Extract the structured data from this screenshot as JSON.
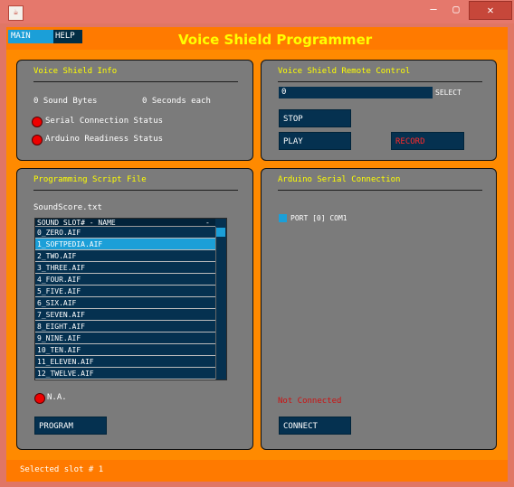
{
  "window": {
    "min_glyph": "—",
    "max_glyph": "▢",
    "close_glyph": "✕",
    "app_icon": "java-cup-icon"
  },
  "menu": {
    "main": "MAIN",
    "help": "HELP"
  },
  "app_title": "Voice Shield Programmer",
  "info_panel": {
    "title": "Voice Shield Info",
    "sound_bytes": "0 Sound Bytes",
    "seconds_each": "0 Seconds each",
    "serial_status": "Serial Connection Status",
    "arduino_status": "Arduino Readiness Status"
  },
  "remote_panel": {
    "title": "Voice Shield Remote Control",
    "slot_value": "0",
    "select_label": "SELECT",
    "stop": "STOP",
    "play": "PLAY",
    "record": "RECORD"
  },
  "script_panel": {
    "title": "Programming Script File",
    "file_name": "SoundScore.txt",
    "list_header": "SOUND SLOT#  - NAME",
    "list_header_sort": "-",
    "items": [
      "0_ZERO.AIF",
      "1_SOFTPEDIA.AIF",
      "2_TWO.AIF",
      "3_THREE.AIF",
      "4_FOUR.AIF",
      "5_FIVE.AIF",
      "6_SIX.AIF",
      "7_SEVEN.AIF",
      "8_EIGHT.AIF",
      "9_NINE.AIF",
      "10_TEN.AIF",
      "11_ELEVEN.AIF",
      "12_TWELVE.AIF"
    ],
    "selected_index": 1,
    "status": "N.A.",
    "program": "PROGRAM"
  },
  "serial_panel": {
    "title": "Arduino Serial Connection",
    "port": "PORT [0] COM1",
    "not_connected": "Not Connected",
    "connect": "CONNECT"
  },
  "status_bar": {
    "text": "Selected slot # 1"
  },
  "colors": {
    "accent": "#ffff00",
    "button_bg": "#053150",
    "selection": "#1b9fd8",
    "panel_bg": "#7b7b7b",
    "record_text": "#ff2a2a",
    "not_connected_text": "#cc1111"
  }
}
